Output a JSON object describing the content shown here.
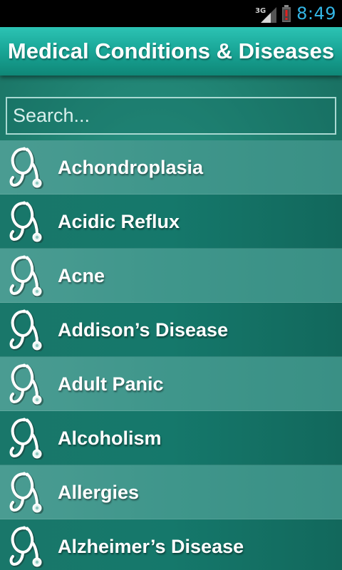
{
  "status_bar": {
    "network": "3G",
    "time": "8:49",
    "icons": [
      "signal-icon",
      "battery-alert-icon"
    ]
  },
  "header": {
    "title": "Medical Conditions & Diseases"
  },
  "search": {
    "placeholder": "Search...",
    "value": ""
  },
  "list": {
    "item_icon": "stethoscope-icon",
    "items": [
      {
        "label": "Achondroplasia"
      },
      {
        "label": "Acidic Reflux"
      },
      {
        "label": "Acne"
      },
      {
        "label": "Addison’s Disease"
      },
      {
        "label": "Adult Panic"
      },
      {
        "label": "Alcoholism"
      },
      {
        "label": "Allergies"
      },
      {
        "label": "Alzheimer’s Disease"
      }
    ]
  },
  "colors": {
    "header_gradient_top": "#2cc3b4",
    "header_gradient_bottom": "#0f8777",
    "row_light": "#3f968b",
    "row_dark": "#15786b",
    "clock": "#33b5e5"
  }
}
